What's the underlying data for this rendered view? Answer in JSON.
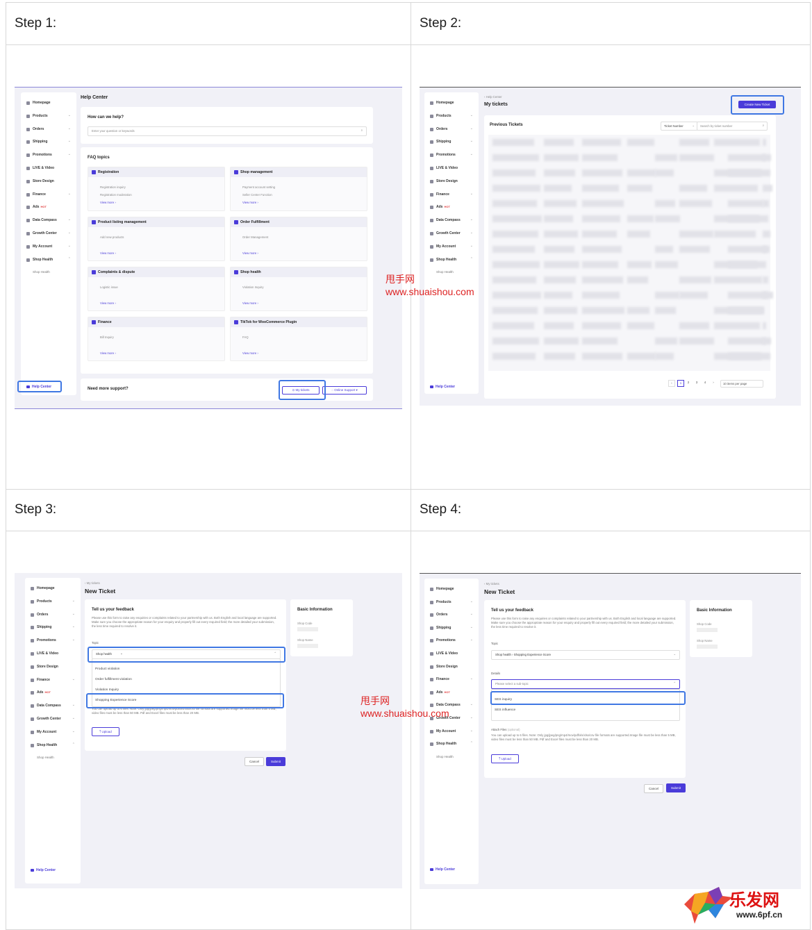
{
  "steps": [
    "Step 1:",
    "Step 2:",
    "Step 3:",
    "Step 4:"
  ],
  "sidebar": {
    "items": [
      {
        "label": "Homepage",
        "chevron": ""
      },
      {
        "label": "Products",
        "chevron": "⌄"
      },
      {
        "label": "Orders",
        "chevron": "⌄"
      },
      {
        "label": "Shipping",
        "chevron": "⌄"
      },
      {
        "label": "Promotions",
        "chevron": "⌄"
      },
      {
        "label": "LIVE & Video",
        "chevron": ""
      },
      {
        "label": "Store Design",
        "chevron": ""
      },
      {
        "label": "Finance",
        "chevron": "⌄"
      },
      {
        "label": "Ads",
        "chevron": "",
        "badge": "HOT"
      },
      {
        "label": "Data Compass",
        "chevron": "⌄"
      },
      {
        "label": "Growth Center",
        "chevron": "⌄"
      },
      {
        "label": "My Account",
        "chevron": "⌄"
      },
      {
        "label": "Shop Health",
        "chevron": "⌃"
      }
    ],
    "sub_item": "Shop Health",
    "help_center": "Help Center"
  },
  "step1": {
    "title": "Help Center",
    "question": "How can we help?",
    "search_placeholder": "Enter your question or keywords",
    "faq_title": "FAQ topics",
    "faq": [
      {
        "title": "Registration",
        "items": [
          "Registration inquiry",
          "Registration moderation"
        ],
        "more": "View more"
      },
      {
        "title": "Shop management",
        "items": [
          "Payment account setting",
          "Seller Center Function"
        ],
        "more": "View more"
      },
      {
        "title": "Product listing management",
        "items": [
          "Add new products"
        ],
        "more": "View more"
      },
      {
        "title": "Order Fulfillment",
        "items": [
          "Order Management"
        ],
        "more": "View more"
      },
      {
        "title": "Complaints & dispute",
        "items": [
          "Logistic issue"
        ],
        "more": "View more"
      },
      {
        "title": "Shop health",
        "items": [
          "Violation Inquiry"
        ],
        "more": "View more"
      },
      {
        "title": "Finance",
        "items": [
          "Bill Inquiry"
        ],
        "more": "View more"
      },
      {
        "title": "TikTok for WooCommerce Plugin",
        "items": [
          "FAQ"
        ],
        "more": "View more"
      }
    ],
    "support_text": "Need more support?",
    "my_tickets": "My tickets",
    "online_support": "Online Support"
  },
  "step2": {
    "breadcrumb": "Help Center",
    "title": "My tickets",
    "create_button": "Create New Ticket",
    "section": "Previous Tickets",
    "filter_label": "Ticket Number",
    "search_placeholder": "Search by ticket number",
    "pages": [
      "1",
      "2",
      "3",
      "4"
    ],
    "per_page": "10 items per page"
  },
  "ticket": {
    "breadcrumb": "My tickets",
    "title": "New Ticket",
    "feedback_title": "Tell us your feedback",
    "feedback_desc": "Please use this form to raise any enquiries or complaints related to your partnership with us. Both English and local language are supported. Make sure you choose the appropriate reason for your enquiry and properly fill out every required field; the more detailed your submission, the less time required to resolve it.",
    "topic_label": "Topic",
    "basic_info": "Basic Information",
    "shop_code": "Shop Code",
    "shop_name": "Shop Name",
    "upload": "Upload",
    "cancel": "Cancel",
    "submit": "Submit",
    "upload_note": "You can upload up to 6 files. Note: Only jpg/jpeg/png/mp4/mov/pdf/xls/xlsx/csv file formats are supported.Image file must be less than 5 MB, video files must be less than 50 MB. Pdf and Excel files must be less than 20 MB."
  },
  "step3": {
    "topic_value": "Shop health",
    "options": [
      "Product violation",
      "Order fulfillment violation",
      "Violation Inquiry",
      "Shopping Experience Score"
    ]
  },
  "step4": {
    "topic_value": "Shop health  ›  Shopping Experience Score",
    "details_label": "Details",
    "details_placeholder": "Please select a sub-topic",
    "options": [
      "SES inquiry",
      "SES influence"
    ],
    "attach_label": "Attach Files",
    "attach_optional": "(optional)"
  },
  "watermark": {
    "cn": "甩手网",
    "url": "www.shuaishou.com"
  },
  "logo": {
    "cn": "乐发网",
    "url": "www.6pf.cn"
  },
  "colors": {
    "accent": "#4a3bd9",
    "highlight": "#3f77e3",
    "hot": "#e03b3b"
  }
}
